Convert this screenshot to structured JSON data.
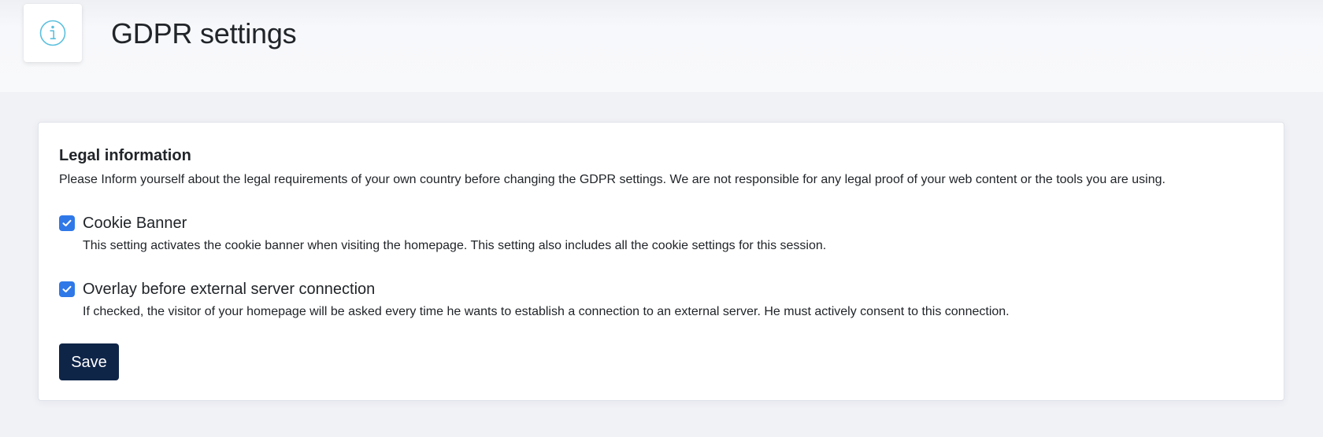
{
  "header": {
    "icon": "info-circle-icon",
    "title": "GDPR settings"
  },
  "legal": {
    "title": "Legal information",
    "description": "Please Inform yourself about the legal requirements of your own country before changing the GDPR settings. We are not responsible for any legal proof of your web content or the tools you are using."
  },
  "options": [
    {
      "label": "Cookie Banner",
      "help": "This setting activates the cookie banner when visiting the homepage. This setting also includes all the cookie settings for this session.",
      "checked": true
    },
    {
      "label": "Overlay before external server connection",
      "help": "If checked, the visitor of your homepage will be asked every time he wants to establish a connection to an external server. He must actively consent to this connection.",
      "checked": true
    }
  ],
  "actions": {
    "save_label": "Save"
  },
  "colors": {
    "accent": "#2f78e8",
    "button": "#0f2548",
    "info_icon": "#5bc0de"
  }
}
